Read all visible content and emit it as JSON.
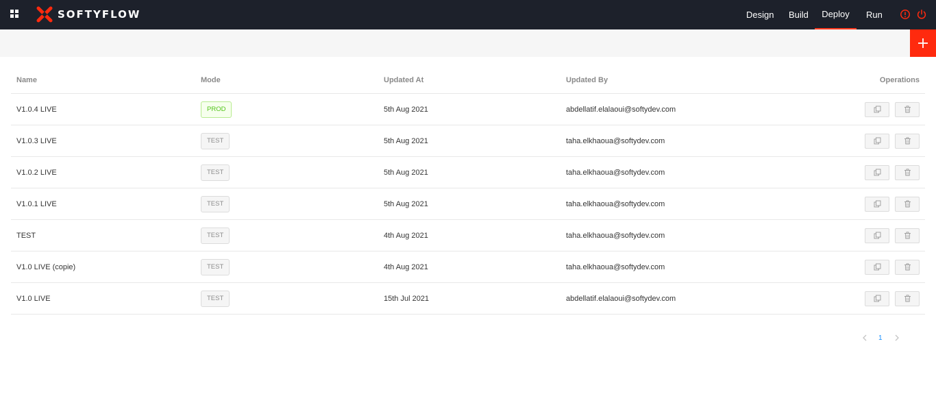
{
  "app": {
    "logo_text": "SOFTYFLOW",
    "accent_color": "#ff2a0e"
  },
  "nav": {
    "items": [
      {
        "label": "Design"
      },
      {
        "label": "Build"
      },
      {
        "label": "Deploy",
        "active": true
      },
      {
        "label": "Run"
      }
    ]
  },
  "toolbar": {
    "add_icon": "plus-icon"
  },
  "table": {
    "columns": {
      "name": "Name",
      "mode": "Mode",
      "updated_at": "Updated At",
      "updated_by": "Updated By",
      "operations": "Operations"
    },
    "rows": [
      {
        "name": "V1.0.4 LIVE",
        "mode": "PROD",
        "updated_at": "5th Aug 2021",
        "updated_by": "abdellatif.elalaoui@softydev.com"
      },
      {
        "name": "V1.0.3 LIVE",
        "mode": "TEST",
        "updated_at": "5th Aug 2021",
        "updated_by": "taha.elkhaoua@softydev.com"
      },
      {
        "name": "V1.0.2 LIVE",
        "mode": "TEST",
        "updated_at": "5th Aug 2021",
        "updated_by": "taha.elkhaoua@softydev.com"
      },
      {
        "name": "V1.0.1 LIVE",
        "mode": "TEST",
        "updated_at": "5th Aug 2021",
        "updated_by": "taha.elkhaoua@softydev.com"
      },
      {
        "name": "TEST",
        "mode": "TEST",
        "updated_at": "4th Aug 2021",
        "updated_by": "taha.elkhaoua@softydev.com"
      },
      {
        "name": "V1.0 LIVE (copie)",
        "mode": "TEST",
        "updated_at": "4th Aug 2021",
        "updated_by": "taha.elkhaoua@softydev.com"
      },
      {
        "name": "V1.0 LIVE",
        "mode": "TEST",
        "updated_at": "15th Jul 2021",
        "updated_by": "abdellatif.elalaoui@softydev.com"
      }
    ]
  },
  "pagination": {
    "current_page": "1",
    "prev_icon": "chevron-left-icon",
    "next_icon": "chevron-right-icon"
  }
}
